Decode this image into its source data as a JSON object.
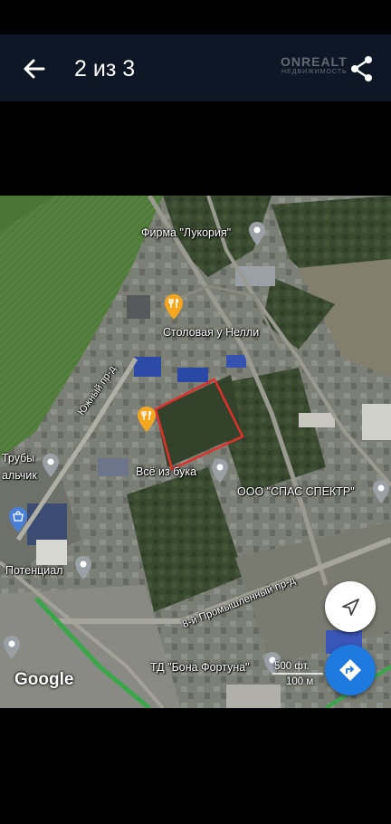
{
  "watermark": {
    "brand": "ONREALT",
    "sub": "НЕДВИЖИМОСТЬ"
  },
  "header": {
    "counter": "2 из 3",
    "back_icon": "arrow-left-icon",
    "share_icon": "share-icon"
  },
  "map": {
    "labels": {
      "firma": "Фирма \"Лукория\"",
      "stolovaya": "Столовая у Нелли",
      "yuzhny": "Южный пр-д",
      "truby": "Трубы",
      "kalchik": "альчик",
      "vse_iz_buka": "Всё из бука",
      "spas_spektr": "ООО \"СПАС СПЕКТР\"",
      "potencial": "Потенциал",
      "promyshlenny": "8-й Промышленный пр-д",
      "bona_fortuna": "ТД \"Бона Фортуна\""
    },
    "google": "Google",
    "scale_ft": "500 фт.",
    "scale_m": "100 м",
    "colors": {
      "plot_outline": "#e0302a",
      "pin_food": "#f4a61e",
      "pin_place": "#9aa0a6",
      "pin_shop": "#4a7fd8",
      "directions": "#1f7ae0"
    }
  }
}
